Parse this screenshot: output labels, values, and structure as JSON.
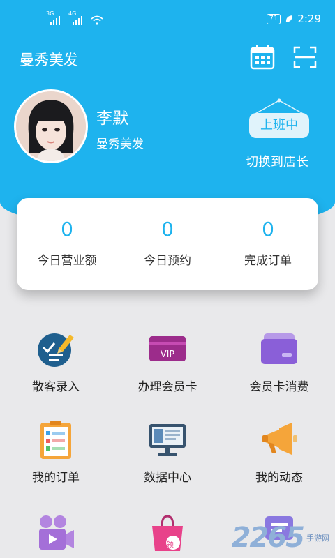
{
  "status_bar": {
    "signal_1": "3G",
    "signal_2": "4G",
    "battery": "71",
    "time": "2:29"
  },
  "header": {
    "title": "曼秀美发"
  },
  "profile": {
    "name": "李默",
    "shop": "曼秀美发",
    "duty_status": "上班中",
    "switch_label": "切换到店长"
  },
  "stats": [
    {
      "value": "0",
      "label": "今日营业额"
    },
    {
      "value": "0",
      "label": "今日预约"
    },
    {
      "value": "0",
      "label": "完成订单"
    }
  ],
  "menu": [
    {
      "label": "散客录入",
      "icon": "walk-in-entry-icon"
    },
    {
      "label": "办理会员卡",
      "icon": "vip-card-icon"
    },
    {
      "label": "会员卡消费",
      "icon": "member-card-payment-icon"
    },
    {
      "label": "我的订单",
      "icon": "order-clipboard-icon"
    },
    {
      "label": "数据中心",
      "icon": "data-center-icon"
    },
    {
      "label": "我的动态",
      "icon": "megaphone-icon"
    },
    {
      "label": "",
      "icon": "video-camera-icon"
    },
    {
      "label": "",
      "icon": "coupon-bag-icon",
      "badge": "领"
    },
    {
      "label": "",
      "icon": "message-icon"
    }
  ],
  "watermark": {
    "number": "2265",
    "text_top": "手游网",
    "text_bottom": ""
  },
  "colors": {
    "primary": "#1eb3ee",
    "background": "#e9e9eb"
  }
}
